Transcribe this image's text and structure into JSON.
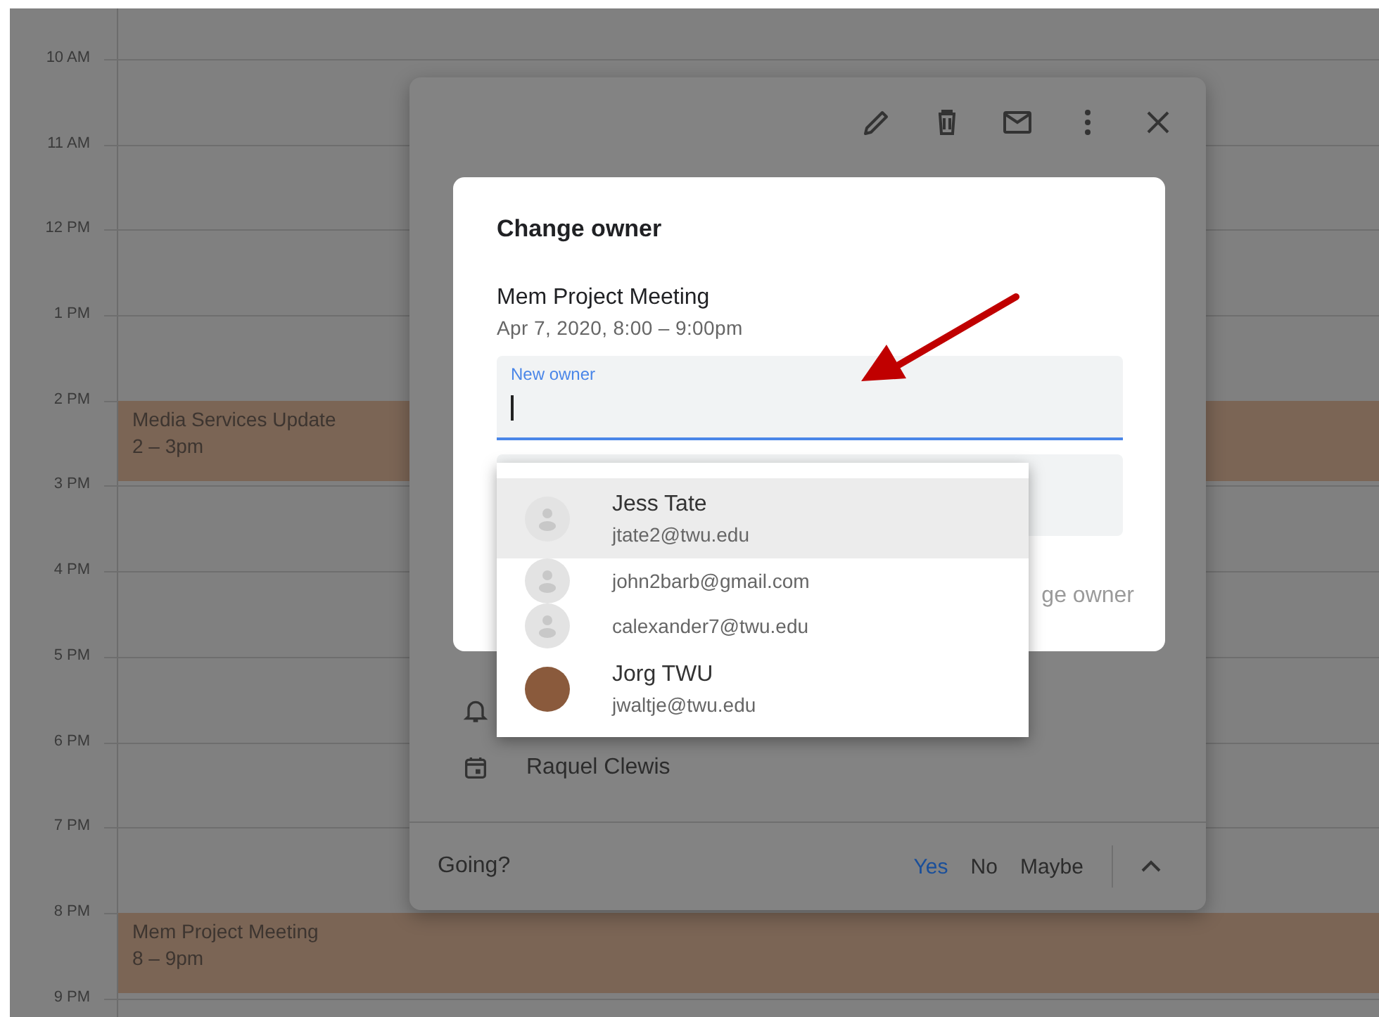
{
  "calendar": {
    "hours": [
      {
        "label": "10 AM"
      },
      {
        "label": "11 AM"
      },
      {
        "label": "12 PM"
      },
      {
        "label": "1 PM"
      },
      {
        "label": "2 PM",
        "events": [
          {
            "title": "Media Services Update",
            "time": "2 – 3pm"
          }
        ]
      },
      {
        "label": "3 PM"
      },
      {
        "label": "4 PM"
      },
      {
        "label": "5 PM"
      },
      {
        "label": "6 PM"
      },
      {
        "label": "7 PM"
      },
      {
        "label": "8 PM",
        "events": [
          {
            "title": "Mem Project Meeting",
            "time": "8 – 9pm"
          }
        ]
      },
      {
        "label": "9 PM"
      }
    ]
  },
  "event_popup": {
    "toolbar": [
      {
        "kind": "edit"
      },
      {
        "kind": "delete"
      },
      {
        "kind": "email"
      },
      {
        "kind": "more"
      },
      {
        "kind": "close"
      }
    ],
    "details": [
      {
        "kind": "notification"
      },
      {
        "kind": "calendar",
        "text": "Raquel Clewis"
      }
    ],
    "footer": {
      "label": "Going?",
      "options": [
        {
          "label": "Yes",
          "selected": true
        },
        {
          "label": "No",
          "selected": false
        },
        {
          "label": "Maybe",
          "selected": false
        }
      ]
    }
  },
  "dialog": {
    "title": "Change owner",
    "event_name": "Mem Project Meeting",
    "event_date": "Apr 7, 2020, 8:00 – 9:00pm",
    "field": {
      "label": "New owner",
      "focused": true
    },
    "button": {
      "label": "ge owner",
      "disabled": true
    }
  },
  "suggestions": [
    {
      "name": "Jess Tate",
      "email": "jtate2@twu.edu",
      "kind": "generic",
      "selected": true
    },
    {
      "email": "john2barb@gmail.com",
      "kind": "generic",
      "selected": false
    },
    {
      "email": "calexander7@twu.edu",
      "kind": "generic",
      "selected": false
    },
    {
      "name": "Jorg TWU",
      "email": "jwaltje@twu.edu",
      "kind": "photo",
      "selected": false
    }
  ]
}
